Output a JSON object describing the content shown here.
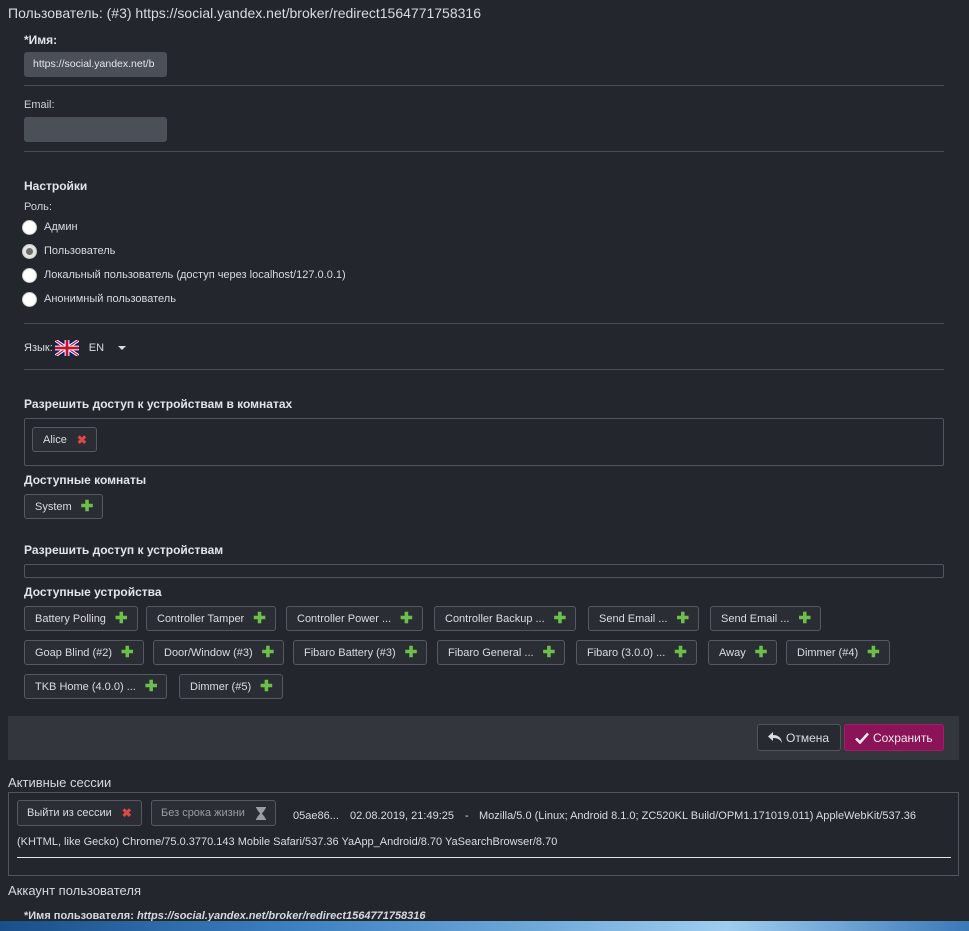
{
  "page": {
    "title": "Пользователь: (#3) https://social.yandex.net/broker/redirect1564771758316"
  },
  "form": {
    "name_label": "*Имя:",
    "name_value": "https://social.yandex.net/b",
    "email_label": "Email:",
    "email_value": ""
  },
  "settings": {
    "title": "Настройки",
    "role_label": "Роль:",
    "roles": [
      {
        "label": "Админ",
        "selected": false
      },
      {
        "label": "Пользователь",
        "selected": true
      },
      {
        "label": "Локальный пользователь (доступ через localhost/127.0.0.1)",
        "selected": false
      },
      {
        "label": "Анонимный пользователь",
        "selected": false
      }
    ],
    "language_label": "Язык:",
    "language_value": "EN"
  },
  "rooms": {
    "allow_title": "Разрешить доступ к устройствам в комнатах",
    "allowed": [
      {
        "label": "Alice"
      }
    ],
    "available_title": "Доступные комнаты",
    "available": [
      {
        "label": "System"
      }
    ]
  },
  "devices": {
    "allow_title": "Разрешить доступ к устройствам",
    "available_title": "Доступные устройства",
    "available": [
      {
        "label": "Battery Polling"
      },
      {
        "label": "Controller Tamper"
      },
      {
        "label": "Controller Power ..."
      },
      {
        "label": "Controller Backup ..."
      },
      {
        "label": "Send Email ..."
      },
      {
        "label": "Send Email ..."
      },
      {
        "label": "Goap Blind (#2)"
      },
      {
        "label": "Door/Window (#3)"
      },
      {
        "label": "Fibaro Battery (#3)"
      },
      {
        "label": "Fibaro General ..."
      },
      {
        "label": "Fibaro (3.0.0) ..."
      },
      {
        "label": "Away"
      },
      {
        "label": "Dimmer (#4)"
      },
      {
        "label": "TKB Home (4.0.0) ..."
      },
      {
        "label": "Dimmer (#5)"
      }
    ]
  },
  "actions": {
    "cancel_label": "Отмена",
    "save_label": "Сохранить"
  },
  "sessions": {
    "title": "Активные сессии",
    "logout_label": "Выйти из сессии",
    "lifetime_label": "Без срока жизни",
    "items": [
      {
        "id": "05ae86...",
        "date": "02.08.2019, 21:49:25",
        "sep": "-",
        "agent_line1": "Mozilla/5.0 (Linux; Android 8.1.0; ZC520KL Build/OPM1.171019.011) AppleWebKit/537.36",
        "agent_line2": "(KHTML, like Gecko) Chrome/75.0.3770.143 Mobile Safari/537.36 YaApp_Android/8.70 YaSearchBrowser/8.70"
      }
    ]
  },
  "account": {
    "title": "Аккаунт пользователя",
    "username_label": "*Имя пользователя:",
    "username_value": "https://social.yandex.net/broker/redirect1564771758316"
  },
  "colors": {
    "accent": "#8b1458",
    "add": "#6dbf4b",
    "remove": "#e04646",
    "background": "#23262d"
  },
  "icons": {
    "add": "plus-icon",
    "remove": "close-icon",
    "undo": "undo-icon",
    "check": "check-icon",
    "hourglass": "hourglass-icon",
    "flag": "uk-flag-icon"
  }
}
